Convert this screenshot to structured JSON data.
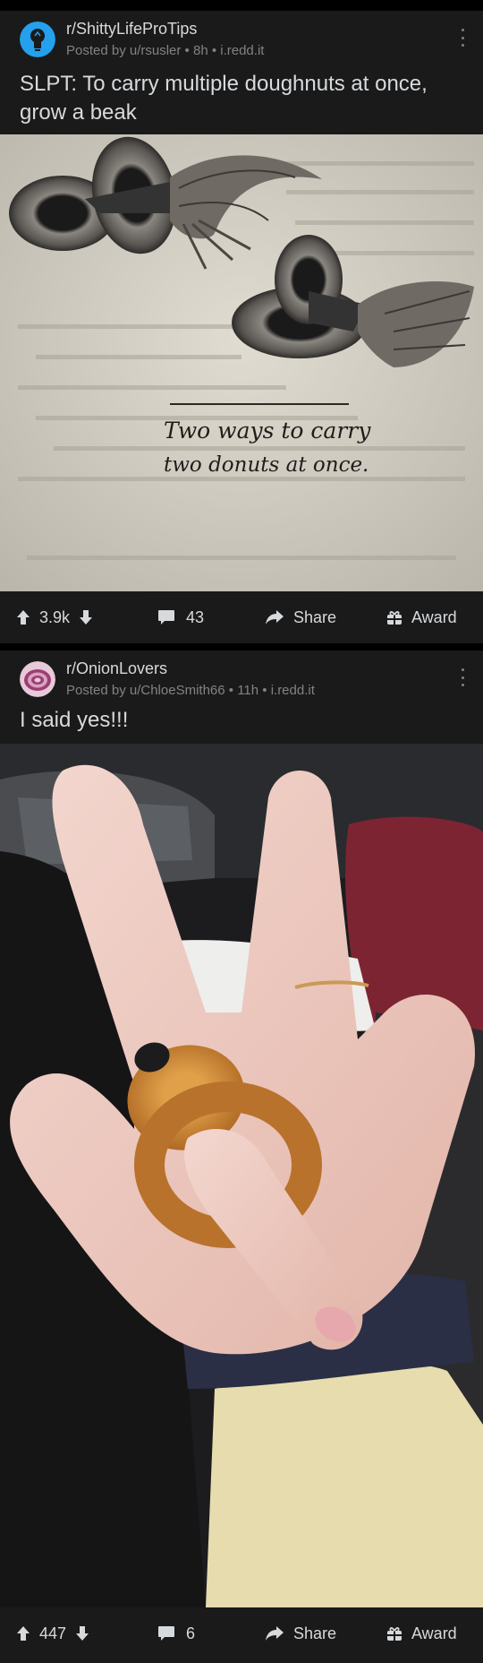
{
  "posts": [
    {
      "subreddit": "r/ShittyLifeProTips",
      "meta": "Posted by u/rsusler • 8h • i.redd.it",
      "title": "SLPT: To carry multiple doughnuts at once, grow a beak",
      "image": {
        "caption_line1": "Two ways to carry",
        "caption_line2": "two donuts at once."
      },
      "votes": "3.9k",
      "comments": "43",
      "share_label": "Share",
      "award_label": "Award"
    },
    {
      "subreddit": "r/OnionLovers",
      "meta": "Posted by u/ChloeSmith66 • 11h • i.redd.it",
      "title": "I said yes!!!",
      "votes": "447",
      "comments": "6",
      "share_label": "Share",
      "award_label": "Award"
    }
  ],
  "colors": {
    "background": "#000000",
    "card": "#1a1a1b",
    "text": "#d7dadc",
    "muted": "#818384",
    "accent": "#24a0ed"
  },
  "icons": [
    "lightbulb-avatar-icon",
    "onion-avatar-icon",
    "more-options-icon",
    "upvote-icon",
    "downvote-icon",
    "comment-icon",
    "share-icon",
    "award-icon"
  ]
}
